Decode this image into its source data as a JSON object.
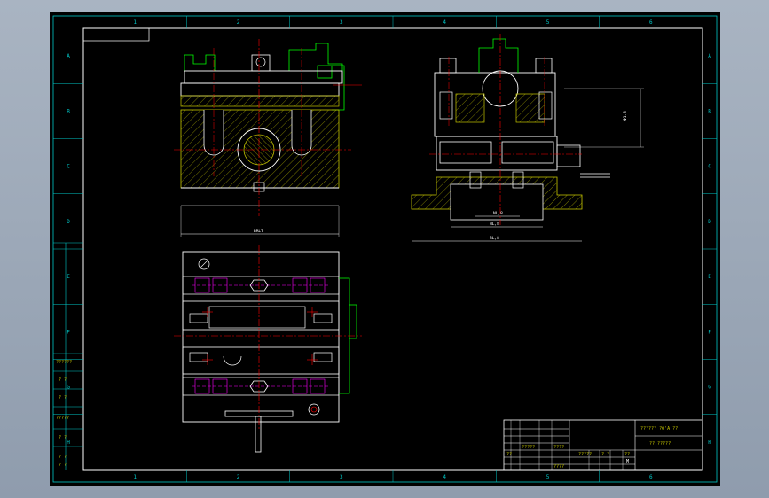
{
  "drawing": {
    "border_color": "#00c8c8",
    "line_color": "#ffffff",
    "part_color": "#00ff00",
    "center_color": "#ff0000",
    "hidden_color": "#ff00ff",
    "hatch_color": "#c8c800",
    "columns": [
      "1",
      "2",
      "3",
      "4",
      "5",
      "6"
    ],
    "rows": [
      "A",
      "B",
      "C",
      "D",
      "E",
      "F",
      "G",
      "H"
    ],
    "dimensions": {
      "front_width": "BRLT",
      "side_height": "Φ1.8",
      "side_inner": "NL,8",
      "side_mid": "NL,8",
      "side_base": "BL,8"
    },
    "side_strip": [
      "??????",
      "? ?",
      "? ?",
      "?????",
      "? ?",
      "? ?",
      "? ?"
    ],
    "title_block": {
      "title": "?????? ?Ф'A ??",
      "drawing_no": "?? ?????",
      "sheet_label": "?????",
      "scale": "? ?",
      "count": "??",
      "mark": "M",
      "small_cells": [
        "??",
        "?????",
        "????",
        "????"
      ]
    }
  }
}
